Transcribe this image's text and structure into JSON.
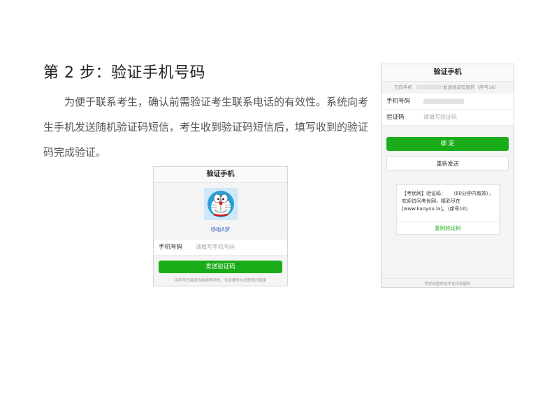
{
  "title": "第 2 步：验证手机号码",
  "paragraph": "为便于联系考生，确认前需验证考生联系电话的有效性。系统向考生手机发送随机验证码短信，考生收到验证码短信后，填写收到的验证码完成验证。",
  "screen1": {
    "header": "验证手机",
    "nickname": "哆啦A梦",
    "phone_label": "手机号码",
    "phone_placeholder": "请填写手机号码",
    "send_button": "发送验证码",
    "footnote": "手机号码将提供给报考学校，仅必要时与您联系时使用"
  },
  "screen2": {
    "header": "验证手机",
    "sent_notice_left": "已向手机",
    "sent_notice_right": "发送验证码短信（序号16）",
    "phone_label": "手机号码",
    "code_label": "验证码",
    "code_placeholder": "请填写验证码",
    "bind_button": "绑 定",
    "resend_button": "重新发送",
    "sms_text": "【考优网】验证码：　　（60分钟内有效），欢迎访问考优网，精彩尽在[www.kaoyou.la]。（序号16）",
    "copy_button": "复制验证码",
    "footer": "考优网提供技术支持和服务"
  },
  "colors": {
    "accent_green": "#1aad19",
    "header_bg": "#fafafa"
  }
}
